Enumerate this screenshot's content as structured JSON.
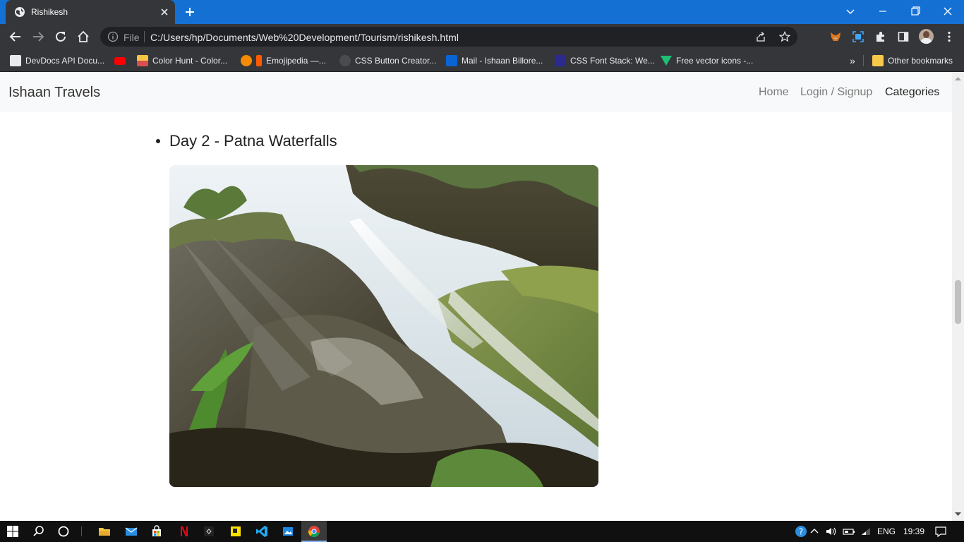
{
  "browser": {
    "tab_title": "Rishikesh",
    "address_prefix": "File",
    "url": "C:/Users/hp/Documents/Web%20Development/Tourism/rishikesh.html",
    "bookmarks": [
      {
        "label": "DevDocs API Docu...",
        "icon": "devdocs-icon",
        "color": "#e8eaed"
      },
      {
        "label": "",
        "icon": "youtube-icon",
        "color": "#ff0000"
      },
      {
        "label": "Color Hunt - Color...",
        "icon": "colorhunt-icon",
        "color": "#f4c542"
      },
      {
        "label": "Emojipedia —...",
        "icon": "emojipedia-icon",
        "color": "#ff6d00"
      },
      {
        "label": "CSS Button Creator...",
        "icon": "gear-icon",
        "color": "#5f6368"
      },
      {
        "label": "Mail - Ishaan Billore...",
        "icon": "outlook-icon",
        "color": "#0a64d6"
      },
      {
        "label": "CSS Font Stack: We...",
        "icon": "cssfontstack-icon",
        "color": "#2a2a8f"
      },
      {
        "label": "Free vector icons -...",
        "icon": "flaticon-icon",
        "color": "#1dbf73"
      }
    ],
    "overflow_label": "»",
    "other_bookmarks": "Other bookmarks"
  },
  "site": {
    "brand": "Ishaan Travels",
    "nav": {
      "home": "Home",
      "login": "Login / Signup",
      "categories": "Categories"
    },
    "day_heading": "Day 2 - Patna Waterfalls",
    "photo_alt": "Patna Waterfalls"
  },
  "taskbar": {
    "language": "ENG",
    "time": "19:39"
  },
  "colors": {
    "tab_strip": "#1570d4",
    "chrome_dark": "#35363a",
    "navbar_bg": "#f8f9fa"
  }
}
